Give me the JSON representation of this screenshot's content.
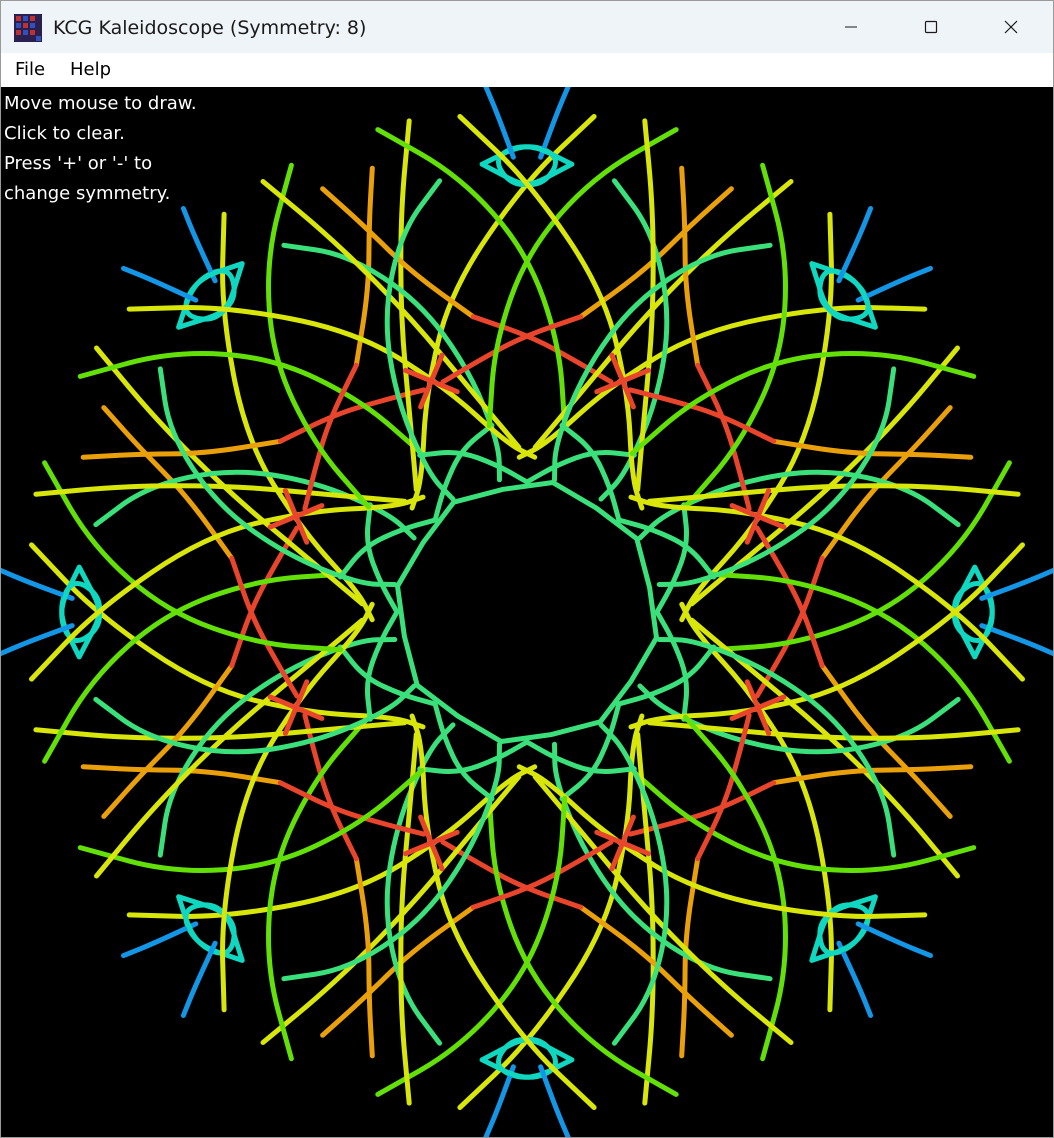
{
  "window": {
    "title": "KCG Kaleidoscope (Symmetry: 8)",
    "app_icon": "kaleidoscope-app-icon",
    "controls": [
      "minimize",
      "maximize",
      "close"
    ]
  },
  "menu": {
    "items": [
      {
        "label": "File"
      },
      {
        "label": "Help"
      }
    ]
  },
  "canvas": {
    "background": "#000000",
    "symmetry": 8,
    "instructions": [
      "Move mouse to draw.",
      "Click to clear.",
      "Press '+' or '-' to",
      "change symmetry."
    ],
    "palette": {
      "red": "#e8452c",
      "orange": "#eaa00a",
      "yellow": "#d8e60a",
      "lime": "#62e008",
      "green": "#3ae07a",
      "cyan": "#10d8c0",
      "blue": "#1496e6"
    }
  }
}
